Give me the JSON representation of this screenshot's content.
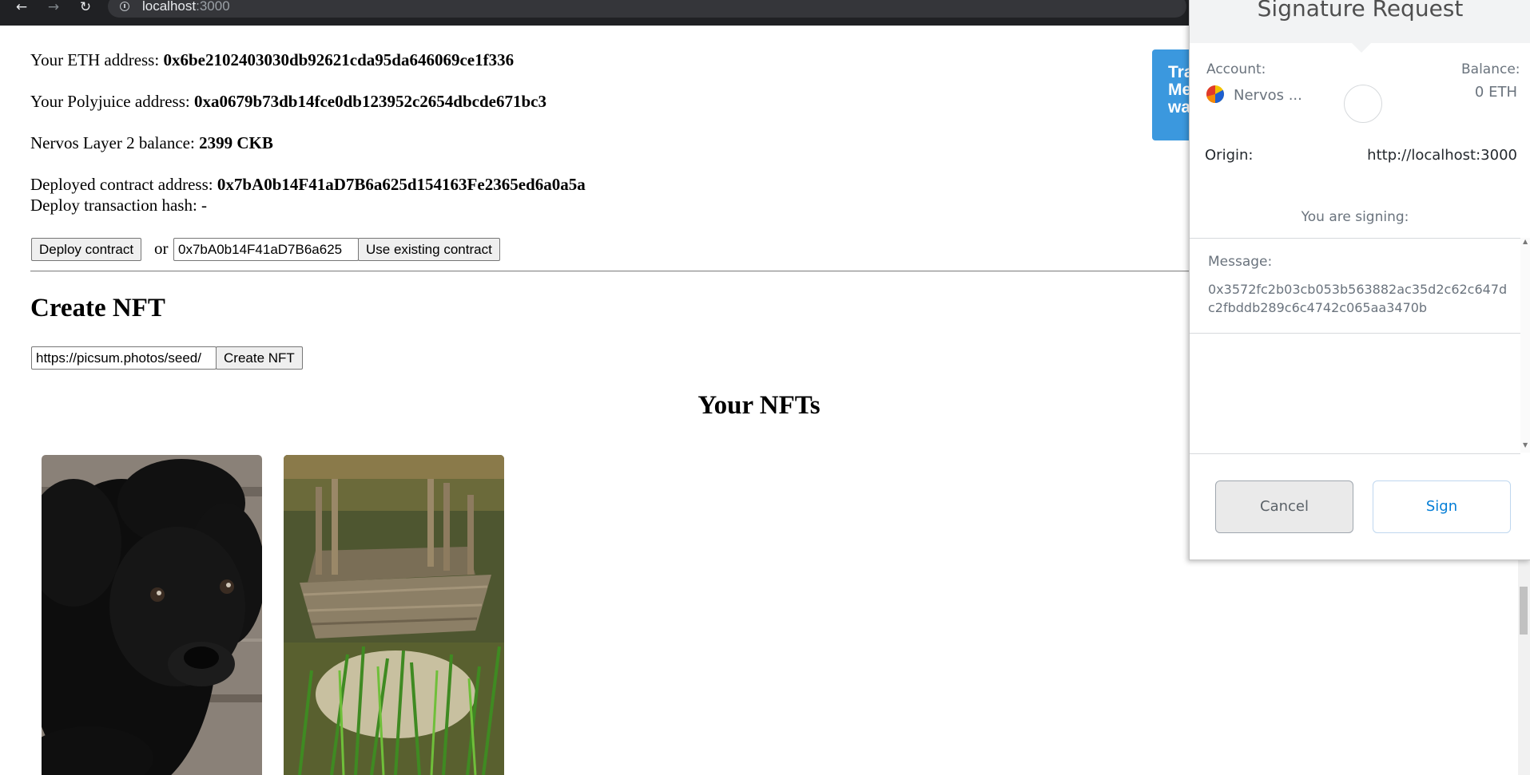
{
  "browser": {
    "url_host": "localhost",
    "url_port": ":3000"
  },
  "page": {
    "eth_label": "Your ETH address: ",
    "eth_value": "0x6be2102403030db92621cda95da646069ce1f336",
    "polyjuice_label": "Your Polyjuice address: ",
    "polyjuice_value": "0xa0679b73db14fce0db123952c2654dbcde671bc3",
    "balance_label": "Nervos Layer 2 balance: ",
    "balance_value": "2399 CKB",
    "contract_label": "Deployed contract address: ",
    "contract_value": "0x7bA0b14F41aD7B6a625d154163Fe2365ed6a0a5a",
    "tx_hash_label": "Deploy transaction hash: -",
    "deploy_button": "Deploy contract",
    "or_text": "or",
    "existing_contract_value": "0x7bA0b14F41aD7B6a625",
    "use_existing_button": "Use existing contract",
    "create_heading": "Create NFT",
    "nft_url_value": "https://picsum.photos/seed/",
    "create_button": "Create NFT",
    "your_nfts_heading": "Your NFTs"
  },
  "toast": {
    "lines": [
      "Tra",
      "Me",
      "wa"
    ],
    "color": "#3b98de"
  },
  "metamask": {
    "title": "Signature Request",
    "account_label": "Account:",
    "account_name": "Nervos ...",
    "balance_label": "Balance:",
    "balance_value": "0 ETH",
    "origin_label": "Origin:",
    "origin_value": "http://localhost:3000",
    "signing_label": "You are signing:",
    "message_label": "Message:",
    "message_value": "0x3572fc2b03cb053b563882ac35d2c62c647dc2fbddb289c6c4742c065aa3470b",
    "cancel_button": "Cancel",
    "sign_button": "Sign",
    "sign_color": "#037dd6"
  },
  "nfts": [
    {
      "subject": "black-puppy-image"
    },
    {
      "subject": "wooden-dock-image"
    }
  ]
}
